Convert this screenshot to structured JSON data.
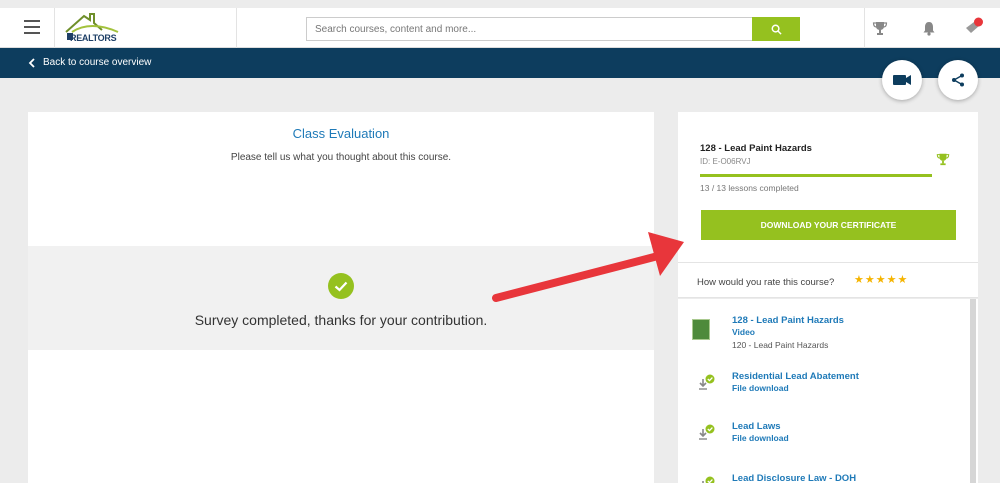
{
  "header": {
    "logo_text": "REALTORS",
    "search_placeholder": "Search courses, content and more...",
    "icons": [
      "menu-icon",
      "search-icon",
      "trophy-icon",
      "bell-icon",
      "notification-icon"
    ]
  },
  "navbar": {
    "back_label": "Back to course overview"
  },
  "fabs": [
    "video-icon",
    "share-icon"
  ],
  "evaluation": {
    "title": "Class Evaluation",
    "subtitle": "Please tell us what you thought about this course.",
    "survey_message": "Survey completed, thanks for your contribution."
  },
  "course": {
    "title": "128 - Lead Paint Hazards",
    "id_label": "ID: E-O06RVJ",
    "lessons_completed": "13 / 13 lessons completed",
    "progress": 1.0,
    "certificate_button": "DOWNLOAD YOUR CERTIFICATE"
  },
  "rating": {
    "prompt": "How would you rate this course?",
    "stars": 5
  },
  "lessons": [
    {
      "name": "128 - Lead Paint Hazards",
      "type": "Video",
      "parent": "120 - Lead Paint Hazards",
      "icon": "video-thumbnail"
    },
    {
      "name": "Residential Lead Abatement",
      "type": "File download",
      "parent": "",
      "icon": "download-icon"
    },
    {
      "name": "Lead Laws",
      "type": "File download",
      "parent": "",
      "icon": "download-icon"
    },
    {
      "name": "Lead Disclosure Law - DOH",
      "type": "",
      "parent": "",
      "icon": "download-icon"
    }
  ],
  "colors": {
    "accent_green": "#95c11f",
    "nav_blue": "#0d3d5e",
    "link_blue": "#1f7ab8",
    "arrow_red": "#e8363b"
  }
}
